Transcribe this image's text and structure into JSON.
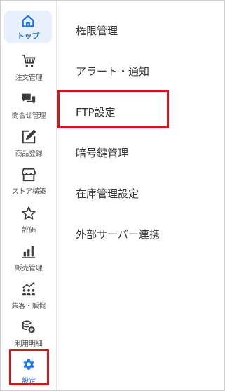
{
  "sidebar": {
    "items": [
      {
        "label": "トップ",
        "icon": "home-icon"
      },
      {
        "label": "注文管理",
        "icon": "cart-icon"
      },
      {
        "label": "問合せ管理",
        "icon": "chat-icon"
      },
      {
        "label": "商品登録",
        "icon": "edit-icon"
      },
      {
        "label": "ストア構築",
        "icon": "store-icon"
      },
      {
        "label": "評価",
        "icon": "star-icon"
      },
      {
        "label": "販売管理",
        "icon": "bar-chart-icon"
      },
      {
        "label": "集客・販促",
        "icon": "people-growth-icon"
      },
      {
        "label": "利用明細",
        "icon": "coins-icon"
      },
      {
        "label": "設定",
        "icon": "gear-icon"
      }
    ]
  },
  "menu": {
    "items": [
      {
        "label": "権限管理"
      },
      {
        "label": "アラート・通知"
      },
      {
        "label": "FTP設定"
      },
      {
        "label": "暗号鍵管理"
      },
      {
        "label": "在庫管理設定"
      },
      {
        "label": "外部サーバー連携"
      }
    ]
  },
  "colors": {
    "accent": "#1a73e8",
    "highlight_border": "#d7131f",
    "home_bg": "#e8f0fd",
    "icon": "#3c3c3c"
  }
}
